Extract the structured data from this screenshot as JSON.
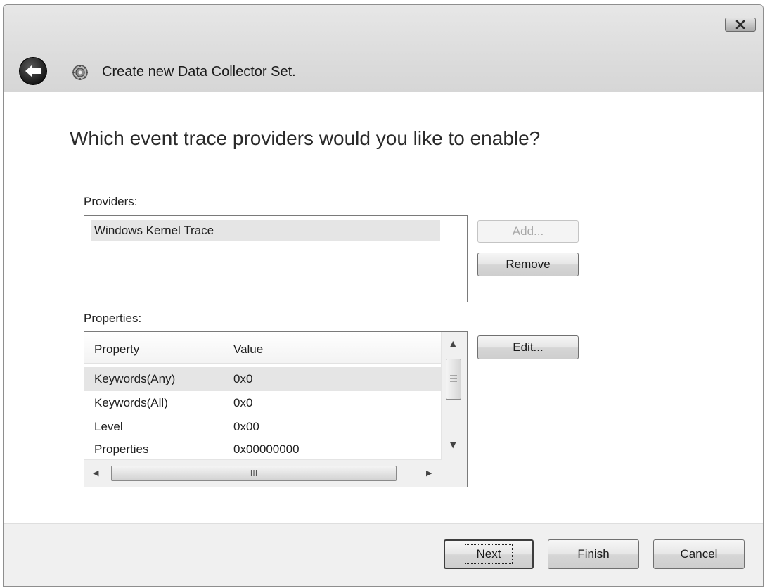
{
  "window": {
    "title": "Create new Data Collector Set."
  },
  "page": {
    "heading": "Which event trace providers would you like to enable?"
  },
  "providers": {
    "label": "Providers:",
    "items": [
      "Windows Kernel Trace"
    ],
    "add_label": "Add...",
    "remove_label": "Remove"
  },
  "properties": {
    "label": "Properties:",
    "columns": [
      "Property",
      "Value"
    ],
    "rows": [
      {
        "property": "Keywords(Any)",
        "value": "0x0"
      },
      {
        "property": "Keywords(All)",
        "value": "0x0"
      },
      {
        "property": "Level",
        "value": "0x00"
      },
      {
        "property": "Properties",
        "value": "0x00000000"
      }
    ],
    "edit_label": "Edit...",
    "hscroll_grip": "III"
  },
  "footer": {
    "next_label": "Next",
    "finish_label": "Finish",
    "cancel_label": "Cancel"
  },
  "icons": {
    "close": "close-icon",
    "back": "back-arrow-icon",
    "app": "gear-icon"
  }
}
